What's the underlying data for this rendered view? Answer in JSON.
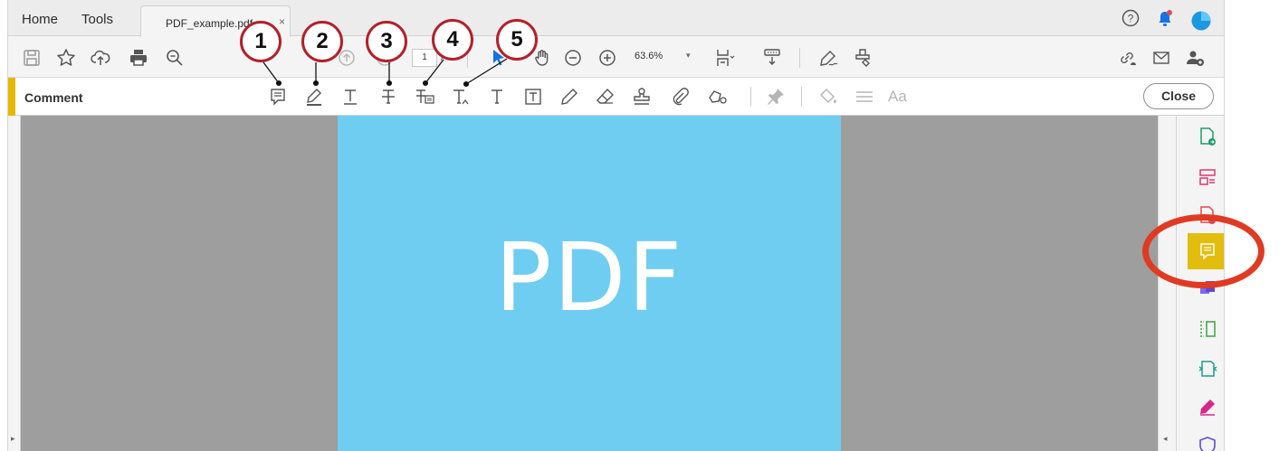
{
  "tabs": {
    "home": "Home",
    "tools": "Tools",
    "document": "PDF_example.pdf",
    "close_glyph": "×"
  },
  "toolbar": {
    "page_current": "1",
    "page_separator": "/",
    "zoom": "63.6%",
    "zoom_caret": "▾",
    "icons": [
      "save-icon",
      "star-icon",
      "cloud-upload-icon",
      "print-icon",
      "zoom-search-icon",
      "page-up-icon",
      "page-down-icon",
      "select-cursor-icon",
      "hand-icon",
      "zoom-out-icon",
      "zoom-in-icon",
      "page-fit-icon",
      "scroll-mode-icon",
      "sign-icon",
      "fill-sign-icon",
      "share-link-icon",
      "email-icon",
      "add-user-icon"
    ]
  },
  "comment_bar": {
    "title": "Comment",
    "close_label": "Close",
    "font_label": "Aa",
    "tools": [
      "sticky-note-icon",
      "highlight-icon",
      "underline-text-icon",
      "strikethrough-icon",
      "replace-text-icon",
      "insert-text-icon",
      "add-text-comment-icon",
      "text-box-icon",
      "pencil-icon",
      "eraser-icon",
      "stamp-icon",
      "attach-icon",
      "shapes-icon",
      "pin-icon",
      "fill-color-icon",
      "line-weight-icon"
    ]
  },
  "document": {
    "text": "PDF",
    "page_color": "#6fcdf2"
  },
  "right_panel": {
    "items": [
      "export-pdf-icon",
      "organize-pages-icon",
      "create-pdf-icon",
      "comment-icon",
      "combine-files-icon",
      "compress-icon",
      "edit-pdf-icon",
      "fill-sign-tool-icon",
      "protect-icon"
    ],
    "active": "comment-icon",
    "active_color": "#e2bd0e"
  },
  "callouts": [
    "1",
    "2",
    "3",
    "4",
    "5"
  ],
  "annotation_color": "#b3202a",
  "highlight_ring_color": "#e03a22",
  "scroll_left_glyph": "▸",
  "scroll_right_glyph": "◂"
}
